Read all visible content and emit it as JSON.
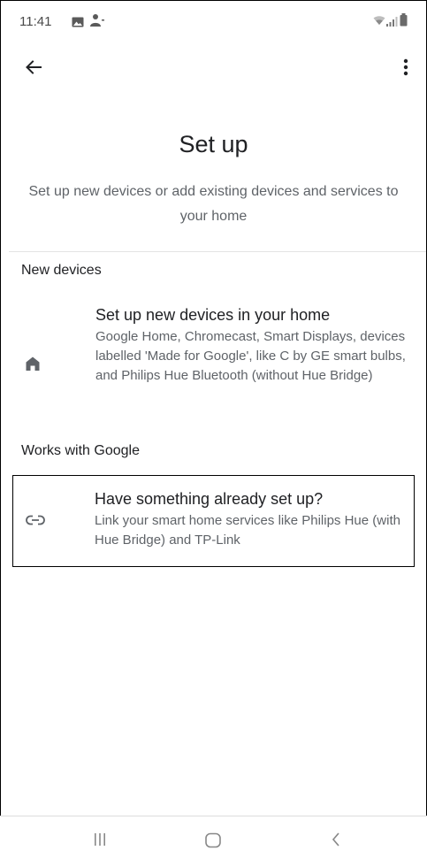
{
  "status_bar": {
    "time": "11:41",
    "icons": [
      "gallery-icon",
      "person-icon",
      "wifi-icon",
      "signal-icon",
      "battery-icon"
    ]
  },
  "app_bar": {
    "back_icon": "arrow-back-icon",
    "menu_icon": "more-vert-icon"
  },
  "header": {
    "title": "Set up",
    "subtitle": "Set up new devices or add existing devices and services to your home"
  },
  "sections": [
    {
      "title": "New devices",
      "item": {
        "icon": "home-icon",
        "title": "Set up new devices in your home",
        "description": "Google Home, Chromecast, Smart Displays, devices labelled 'Made for Google', like C by GE smart bulbs, and Philips Hue Bluetooth (without Hue Bridge)"
      }
    },
    {
      "title": "Works with Google",
      "item": {
        "icon": "link-icon",
        "title": "Have something already set up?",
        "description": "Link your smart home services like Philips Hue (with Hue Bridge) and TP-Link"
      }
    }
  ],
  "nav_bar": {
    "icons": [
      "recent-apps-icon",
      "home-nav-icon",
      "back-nav-icon"
    ]
  },
  "colors": {
    "primary_text": "#202124",
    "secondary_text": "#5f6368",
    "icon": "#5f6368",
    "divider": "#e3e3e3"
  }
}
